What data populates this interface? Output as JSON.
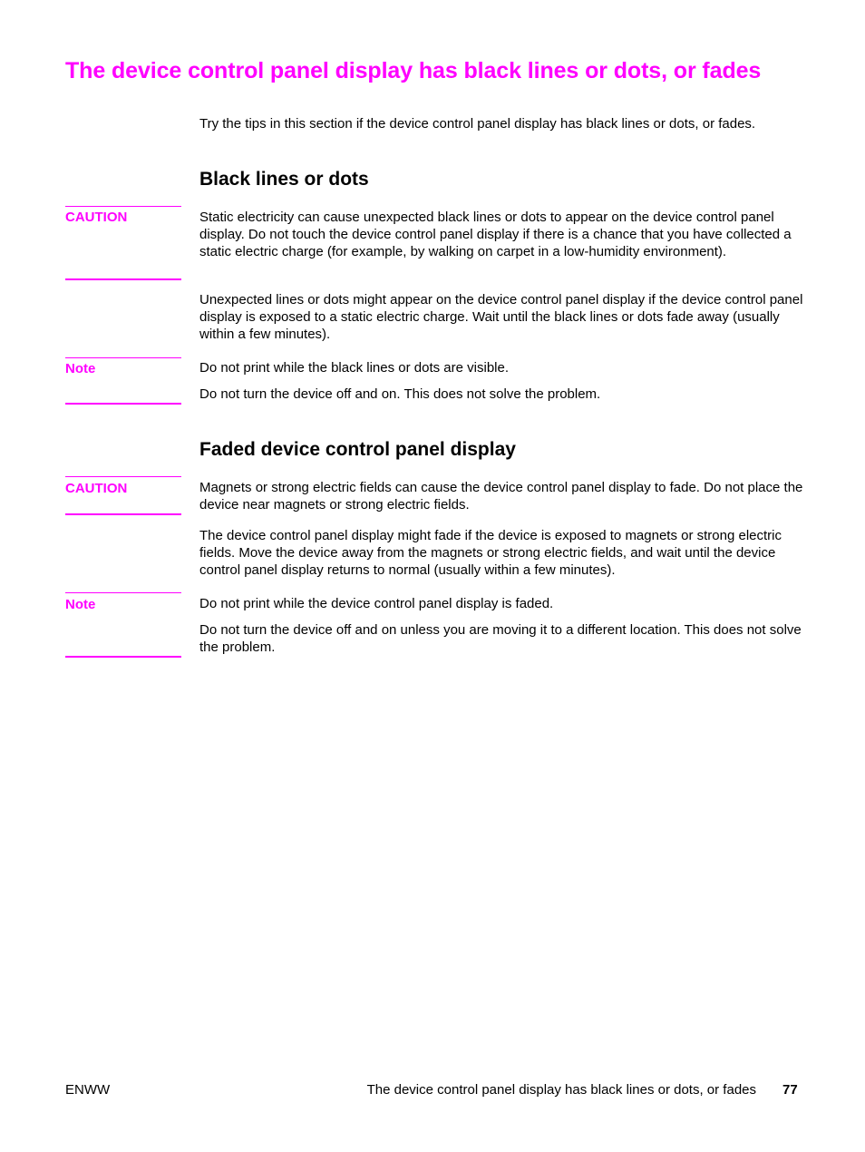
{
  "page": {
    "title": "The device control panel display has black lines or dots, or fades",
    "intro": "Try the tips in this section if the device control panel display has black lines or dots, or fades.",
    "accent_color": "#ff00ff"
  },
  "sections": [
    {
      "heading": "Black lines or dots",
      "caution": {
        "label": "CAUTION",
        "text": "Static electricity can cause unexpected black lines or dots to appear on the device control panel display. Do not touch the device control panel display if there is a chance that you have collected a static electric charge (for example, by walking on carpet in a low-humidity environment)."
      },
      "body": "Unexpected lines or dots might appear on the device control panel display if the device control panel display is exposed to a static electric charge. Wait until the black lines or dots fade away (usually within a few minutes).",
      "note": {
        "label": "Note",
        "lines": [
          "Do not print while the black lines or dots are visible.",
          "Do not turn the device off and on. This does not solve the problem."
        ]
      }
    },
    {
      "heading": "Faded device control panel display",
      "caution": {
        "label": "CAUTION",
        "text": "Magnets or strong electric fields can cause the device control panel display to fade. Do not place the device near magnets or strong electric fields."
      },
      "body": "The device control panel display might fade if the device is exposed to magnets or strong electric fields. Move the device away from the magnets or strong electric fields, and wait until the device control panel display returns to normal (usually within a few minutes).",
      "note": {
        "label": "Note",
        "lines": [
          "Do not print while the device control panel display is faded.",
          "Do not turn the device off and on unless you are moving it to a different location. This does not solve the problem."
        ]
      }
    }
  ],
  "footer": {
    "left": "ENWW",
    "running_title": "The device control panel display has black lines or dots, or fades",
    "page_number": "77"
  }
}
